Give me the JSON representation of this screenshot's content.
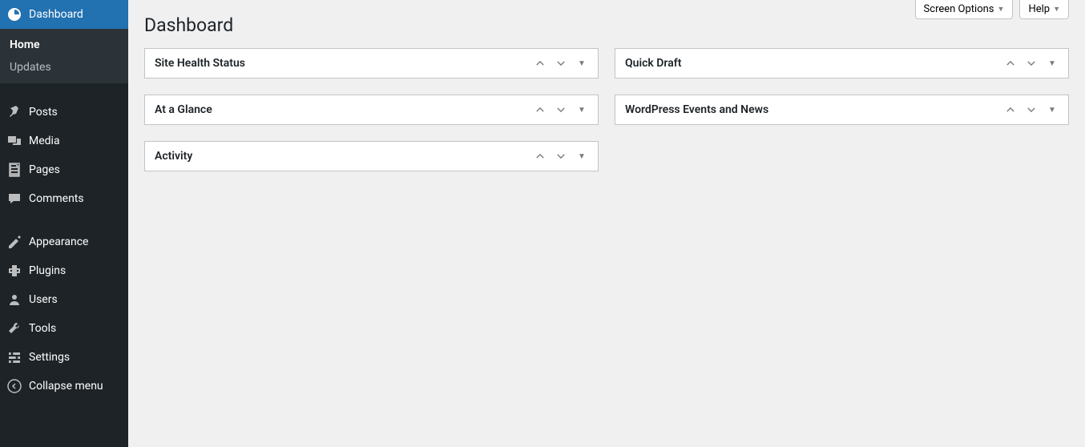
{
  "sidebar": {
    "items": [
      {
        "label": "Dashboard",
        "icon": "dashboard"
      },
      {
        "label": "Posts",
        "icon": "pin"
      },
      {
        "label": "Media",
        "icon": "media"
      },
      {
        "label": "Pages",
        "icon": "pages"
      },
      {
        "label": "Comments",
        "icon": "comments"
      },
      {
        "label": "Appearance",
        "icon": "appearance"
      },
      {
        "label": "Plugins",
        "icon": "plugins"
      },
      {
        "label": "Users",
        "icon": "users"
      },
      {
        "label": "Tools",
        "icon": "tools"
      },
      {
        "label": "Settings",
        "icon": "settings"
      },
      {
        "label": "Collapse menu",
        "icon": "collapse"
      }
    ],
    "submenu": {
      "items": [
        {
          "label": "Home"
        },
        {
          "label": "Updates"
        }
      ]
    }
  },
  "header": {
    "screen_options": "Screen Options",
    "help": "Help"
  },
  "page": {
    "title": "Dashboard"
  },
  "metaboxes": {
    "left": [
      {
        "title": "Site Health Status"
      },
      {
        "title": "At a Glance"
      },
      {
        "title": "Activity"
      }
    ],
    "right": [
      {
        "title": "Quick Draft"
      },
      {
        "title": "WordPress Events and News"
      }
    ]
  }
}
